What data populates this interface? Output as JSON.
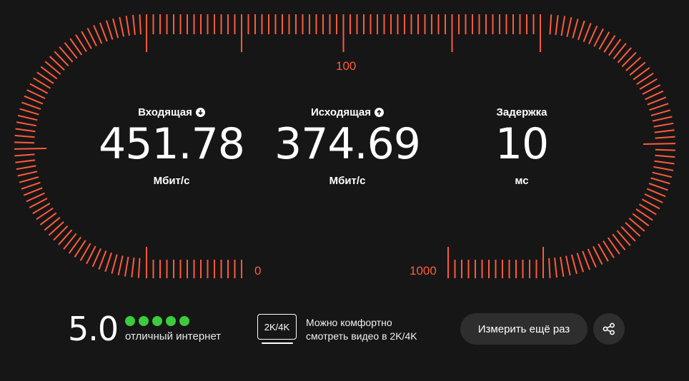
{
  "scale": {
    "label_top": "100",
    "label_left": "0",
    "label_right": "1000"
  },
  "metrics": {
    "download": {
      "title": "Входящая",
      "value": "451.78",
      "unit": "Мбит/с",
      "icon": "arrow-down-icon"
    },
    "upload": {
      "title": "Исходящая",
      "value": "374.69",
      "unit": "Мбит/с",
      "icon": "arrow-up-icon"
    },
    "latency": {
      "title": "Задержка",
      "value": "10",
      "unit": "мс"
    }
  },
  "rating": {
    "score": "5.0",
    "dots_filled": 5,
    "dots_total": 5,
    "text": "отличный интернет"
  },
  "video": {
    "badge": "2K/4K",
    "line1": "Можно комфортно",
    "line2": "смотреть видео в 2K/4K"
  },
  "actions": {
    "retry_label": "Измерить ещё раз",
    "share_icon": "share-icon"
  },
  "colors": {
    "accent": "#ff5a3c",
    "background": "#161616",
    "good": "#3ccb3c",
    "button": "#2e2e2e"
  }
}
